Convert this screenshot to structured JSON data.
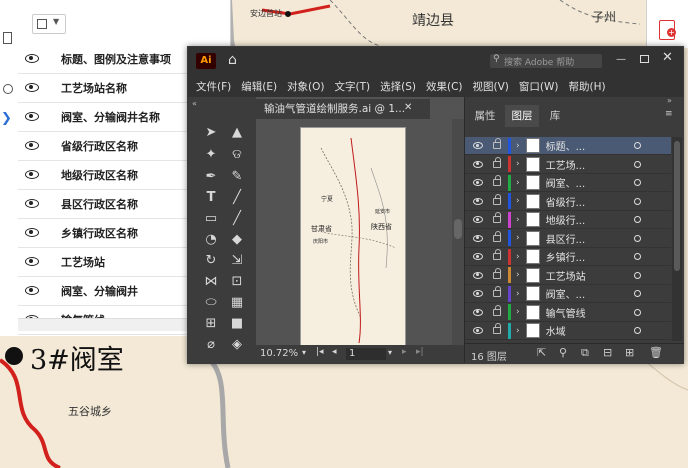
{
  "map": {
    "top_labels": [
      "安边首站",
      "靖边县",
      "子州"
    ],
    "station_label": "3#阀室",
    "town_label": "五谷城乡"
  },
  "left_panel": {
    "items": [
      {
        "label": "标题、图例及注意事项"
      },
      {
        "label": "工艺场站名称"
      },
      {
        "label": "阀室、分输阀井名称"
      },
      {
        "label": "省级行政区名称"
      },
      {
        "label": "地级行政区名称"
      },
      {
        "label": "县区行政区名称"
      },
      {
        "label": "乡镇行政区名称"
      },
      {
        "label": "工艺场站"
      },
      {
        "label": "阀室、分输阀井"
      },
      {
        "label": "输气管线"
      }
    ]
  },
  "illustrator": {
    "logo": "Ai",
    "search_placeholder": "搜索 Adobe 帮助",
    "menu": [
      "文件(F)",
      "编辑(E)",
      "对象(O)",
      "文字(T)",
      "选择(S)",
      "效果(C)",
      "视图(V)",
      "窗口(W)",
      "帮助(H)"
    ],
    "doc_tab": "输油气管道绘制服务.ai @ 1...",
    "zoom": "10.72%",
    "artboard_number": "1",
    "artboard_labels": [
      "甘肃省",
      "宁夏",
      "陕西省",
      "延安市",
      "庆阳市"
    ],
    "panel_tabs": [
      "属性",
      "图层",
      "库"
    ],
    "layers": [
      {
        "name": "标题、...",
        "color": "#2255dd",
        "selected": true
      },
      {
        "name": "工艺场...",
        "color": "#cc3333"
      },
      {
        "name": "阀室、...",
        "color": "#22aa44"
      },
      {
        "name": "省级行...",
        "color": "#2255dd"
      },
      {
        "name": "地级行...",
        "color": "#cc44cc"
      },
      {
        "name": "县区行...",
        "color": "#2255dd"
      },
      {
        "name": "乡镇行...",
        "color": "#cc3333"
      },
      {
        "name": "工艺场站",
        "color": "#cc8833"
      },
      {
        "name": "阀室、...",
        "color": "#6644cc"
      },
      {
        "name": "输气管线",
        "color": "#22aa44"
      },
      {
        "name": "水域",
        "color": "#22aaaa"
      }
    ],
    "layer_count": "16 图层"
  },
  "colors": {
    "map_bg": "#f3e9d6",
    "pipeline": "#d2201c",
    "ai_dark": "#323232",
    "ai_panel": "#3c3c3c",
    "selected_layer": "#4a5a75"
  }
}
